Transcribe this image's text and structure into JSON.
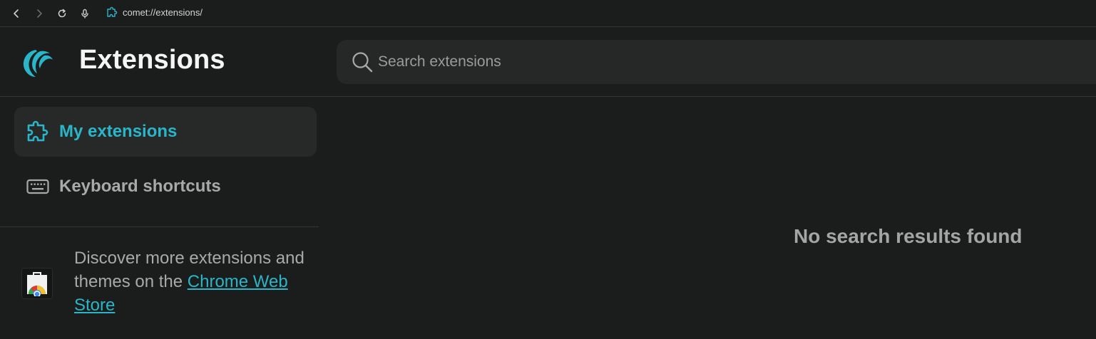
{
  "browser": {
    "url": "comet://extensions/"
  },
  "header": {
    "title": "Extensions",
    "search_placeholder": "Search extensions"
  },
  "sidebar": {
    "items": [
      {
        "label": "My extensions",
        "icon": "puzzle-icon",
        "active": true
      },
      {
        "label": "Keyboard shortcuts",
        "icon": "keyboard-icon",
        "active": false
      }
    ],
    "promo_line1": "Discover more extensions and themes on the",
    "promo_link": "Chrome Web Store"
  },
  "main": {
    "empty_message": "No search results found"
  },
  "colors": {
    "accent": "#2bb5c9",
    "background": "#1b1c1c"
  }
}
